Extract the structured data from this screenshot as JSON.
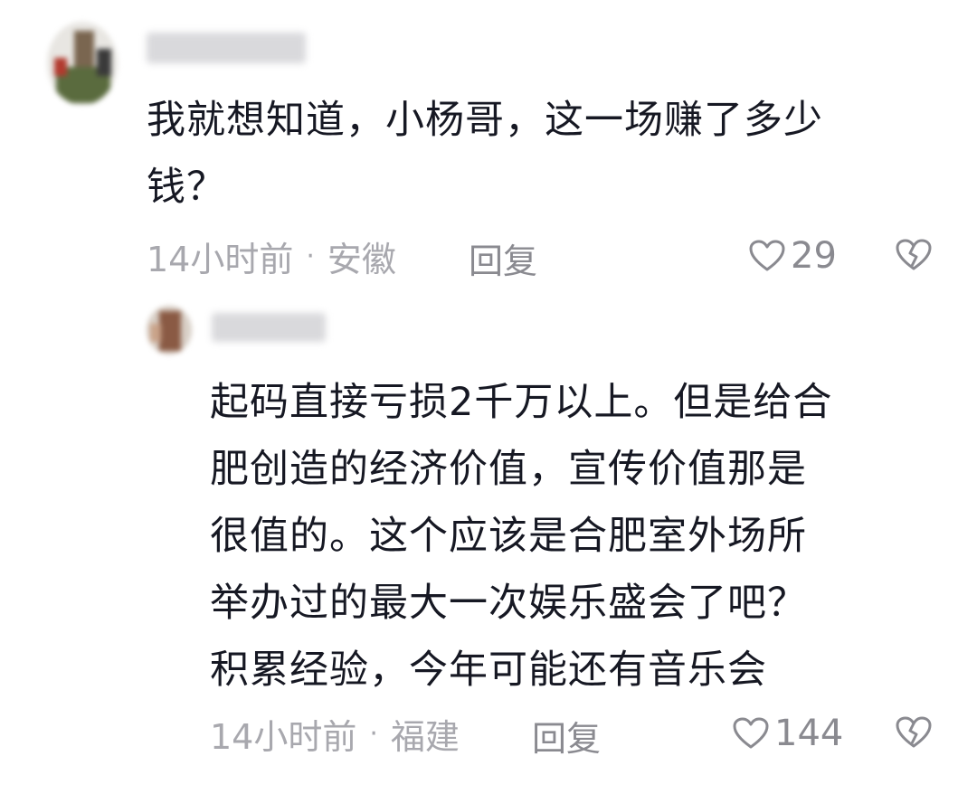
{
  "comments": [
    {
      "text": "我就想知道，小杨哥，这一场赚了多少\n钱？",
      "time": "14小时前",
      "separator": "·",
      "location": "安徽",
      "reply_label": "回复",
      "likes": "29"
    }
  ],
  "replies": [
    {
      "text": "起码直接亏损2千万以上。但是给合\n肥创造的经济价值，宣传价值那是\n很值的。这个应该是合肥室外场所\n举办过的最大一次娱乐盛会了吧？\n积累经验，今年可能还有音乐会",
      "time": "14小时前",
      "separator": "·",
      "location": "福建",
      "reply_label": "回复",
      "likes": "144"
    }
  ],
  "icons": {
    "like": "heart-outline-icon",
    "dislike": "broken-heart-icon"
  },
  "colors": {
    "text": "#161823",
    "meta": "#a8a8ae",
    "action": "#8a8a90"
  }
}
